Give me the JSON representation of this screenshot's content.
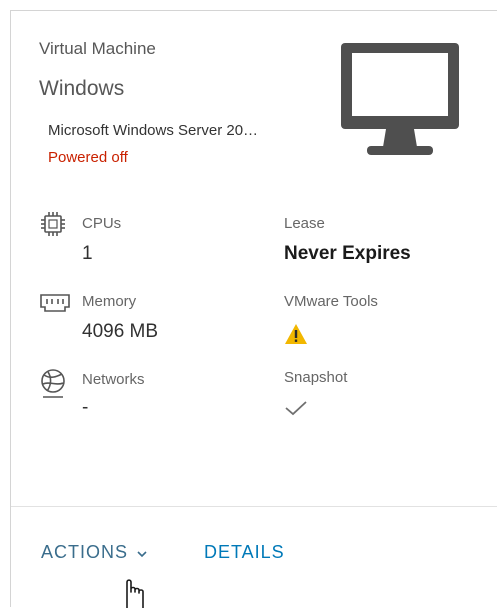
{
  "vm": {
    "type_label": "Virtual Machine",
    "os_family": "Windows",
    "guest_os": "Microsoft Windows Server 20…",
    "power_state": "Powered off",
    "power_state_color": "#c92100",
    "icon": "monitor-icon"
  },
  "stats": {
    "cpus": {
      "label": "CPUs",
      "value": "1",
      "icon": "cpu-icon"
    },
    "memory": {
      "label": "Memory",
      "value": "4096 MB",
      "icon": "memory-icon"
    },
    "networks": {
      "label": "Networks",
      "value": "-",
      "icon": "network-globe-icon"
    },
    "lease": {
      "label": "Lease",
      "value": "Never Expires"
    },
    "vmware_tools": {
      "label": "VMware Tools",
      "icon": "warning-icon",
      "icon_color": "#f2b700"
    },
    "snapshot": {
      "label": "Snapshot",
      "icon": "checkmark-icon"
    }
  },
  "footer": {
    "actions_label": "ACTIONS",
    "details_label": "DETAILS",
    "link_color": "#0079b8"
  }
}
